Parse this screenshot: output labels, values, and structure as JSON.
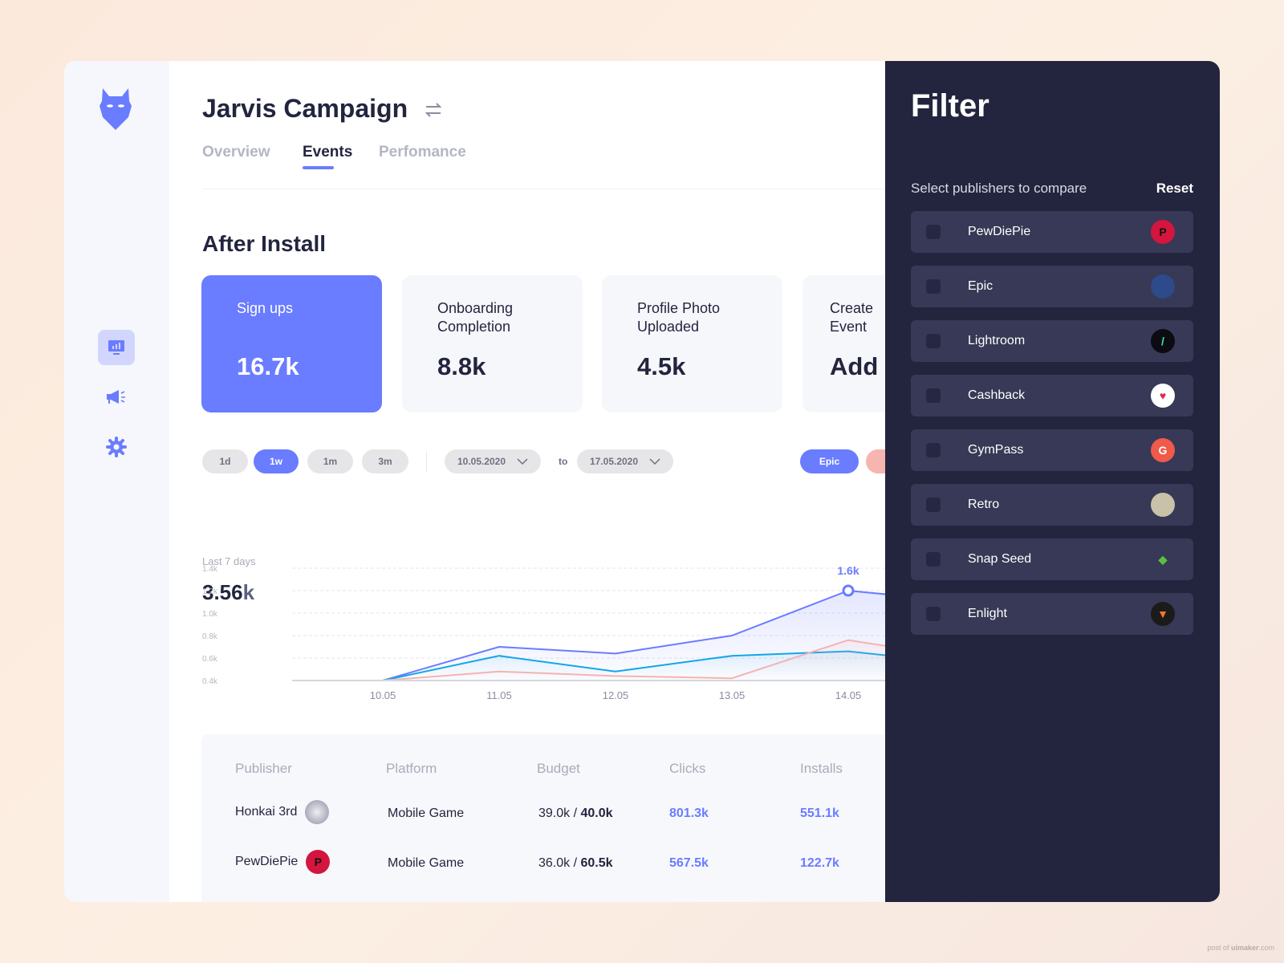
{
  "header": {
    "title": "Jarvis Campaign",
    "tabs": [
      {
        "label": "Overview"
      },
      {
        "label": "Events",
        "active": true
      },
      {
        "label": "Perfomance"
      }
    ]
  },
  "section": {
    "title": "After Install"
  },
  "stats": [
    {
      "label": "Sign ups",
      "value": "16.7k",
      "active": true
    },
    {
      "label": "Onboarding Completion",
      "value": "8.8k"
    },
    {
      "label": "Profile Photo Uploaded",
      "value": "4.5k"
    },
    {
      "label": "Create Event",
      "value": "Add"
    }
  ],
  "controls": {
    "ranges": [
      "1d",
      "1w",
      "1m",
      "3m"
    ],
    "selected_range": "1w",
    "date_from": "10.05.2020",
    "to_label": "to",
    "date_to": "17.05.2020",
    "series_chips": [
      {
        "label": "Epic",
        "color": "#6a7cff"
      },
      {
        "label": "",
        "color": "#f7b5b0"
      }
    ]
  },
  "summary": {
    "period": "Last 7 days",
    "value": "3.56",
    "unit": "k"
  },
  "chart_data": {
    "type": "area",
    "categories": [
      "10.05",
      "11.05",
      "12.05",
      "13.05",
      "14.05"
    ],
    "yticks": [
      "1.4k",
      "1.2k",
      "1.0k",
      "0.8k",
      "0.6k",
      "0.4k"
    ],
    "ylim": [
      0.4,
      1.4
    ],
    "grid": true,
    "series": [
      {
        "color": "#6a7cff",
        "values": [
          0.4,
          0.7,
          0.64,
          0.8,
          1.2,
          1.1
        ]
      },
      {
        "color": "#13a6e8",
        "values": [
          0.4,
          0.62,
          0.48,
          0.62,
          0.66,
          0.55
        ]
      },
      {
        "color": "#f4b3b3",
        "values": [
          0.4,
          0.48,
          0.44,
          0.42,
          0.76,
          0.6
        ]
      }
    ],
    "annotation": {
      "category": "14.05",
      "label": "1.6k"
    }
  },
  "table": {
    "headers": [
      "Publisher",
      "Platform",
      "Budget",
      "Clicks",
      "Installs"
    ],
    "rows": [
      {
        "publisher": "Honkai 3rd",
        "platform": "Mobile Game",
        "budget_spent": "39.0k",
        "budget_sep": " / ",
        "budget_total": "40.0k",
        "clicks": "801.3k",
        "installs": "551.1k"
      },
      {
        "publisher": "PewDiePie",
        "platform": "Mobile Game",
        "budget_spent": "36.0k",
        "budget_sep": " / ",
        "budget_total": "60.5k",
        "clicks": "567.5k",
        "installs": "122.7k"
      }
    ]
  },
  "filter": {
    "title": "Filter",
    "subtitle": "Select publishers to compare",
    "reset": "Reset",
    "publishers": [
      {
        "name": "PewDiePie",
        "color": "#d4153d"
      },
      {
        "name": "Epic",
        "color": "#2d4a8a"
      },
      {
        "name": "Lightroom",
        "color": "#0b0b12"
      },
      {
        "name": "Cashback",
        "color": "#ffffff"
      },
      {
        "name": "GymPass",
        "color": "#ef5a4a"
      },
      {
        "name": "Retro",
        "color": "#c9c1a8"
      },
      {
        "name": "Snap Seed",
        "color": "#373956"
      },
      {
        "name": "Enlight",
        "color": "#1b1b1b"
      }
    ]
  },
  "sidebar": {
    "items": [
      "dashboard-icon",
      "megaphone-icon",
      "gear-icon"
    ]
  }
}
